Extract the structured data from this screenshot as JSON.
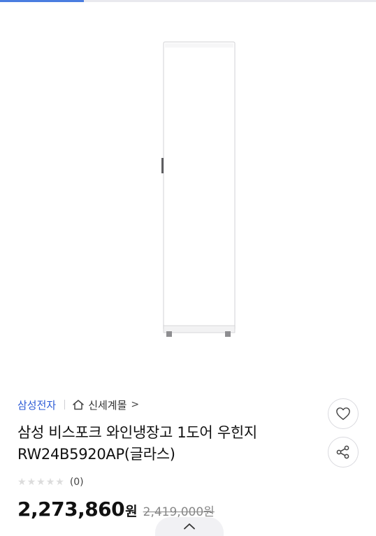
{
  "product": {
    "brand": "삼성전자",
    "store": "신세계몰",
    "store_chevron": ">",
    "title": "삼성 비스포크 와인냉장고 1도어 우힌지 RW24B5920AP(글라스)",
    "rating": 0,
    "review_count": "(0)",
    "price": "2,273,860",
    "price_unit": "원",
    "original_price": "2,419,000원"
  },
  "icons": {
    "store": "home-icon",
    "wishlist": "heart-icon",
    "share": "share-icon",
    "scroll": "chevron-up-icon"
  },
  "colors": {
    "brand_link": "#2c5bd6",
    "tab_indicator": "#4a7de0"
  }
}
